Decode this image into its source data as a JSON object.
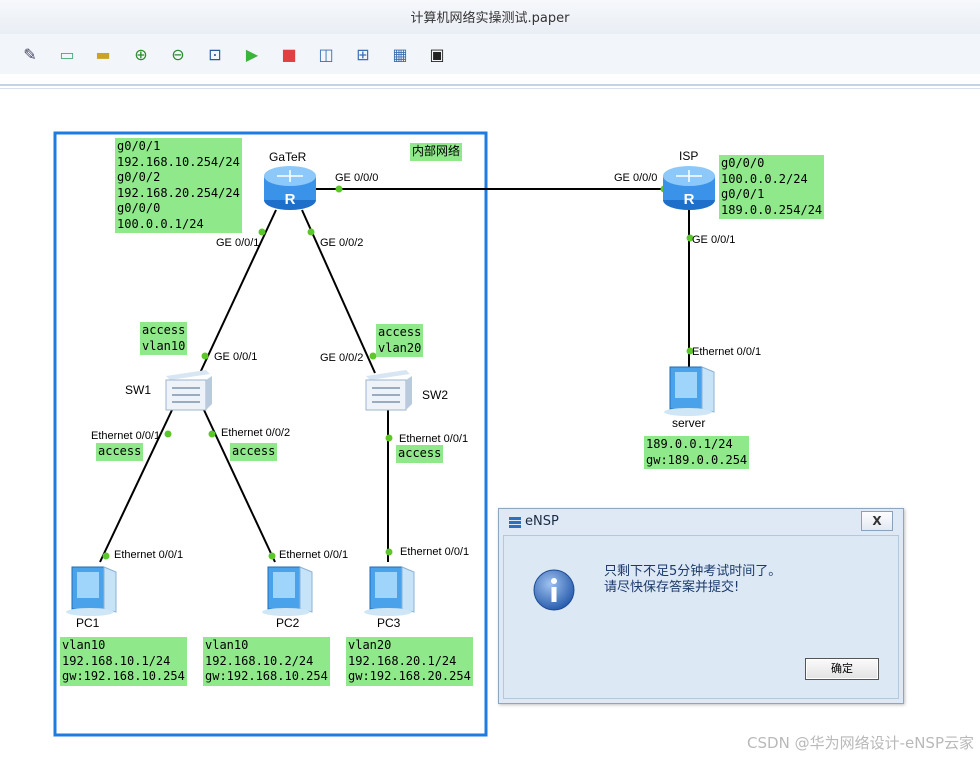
{
  "window": {
    "title": "计算机网络实操测试.paper"
  },
  "toolbar": {
    "buttons": [
      {
        "name": "settings-tool-icon",
        "glyph": "✎"
      },
      {
        "name": "text-tool-icon",
        "glyph": "▭"
      },
      {
        "name": "palette-tool-icon",
        "glyph": "▬"
      },
      {
        "name": "zoom-in-icon",
        "glyph": "⊕"
      },
      {
        "name": "zoom-out-icon",
        "glyph": "⊖"
      },
      {
        "name": "fit-view-icon",
        "glyph": "⊡"
      },
      {
        "name": "start-device-icon",
        "glyph": "▶"
      },
      {
        "name": "stop-device-icon",
        "glyph": "■"
      },
      {
        "name": "capture-icon",
        "glyph": "◫"
      },
      {
        "name": "topology-icon",
        "glyph": "⊞"
      },
      {
        "name": "grid-icon",
        "glyph": "▦"
      },
      {
        "name": "console-icon",
        "glyph": "▣"
      }
    ]
  },
  "topology": {
    "zone_label": "内部网络",
    "devices": {
      "gater": "GaTeR",
      "isp": "ISP",
      "sw1": "SW1",
      "sw2": "SW2",
      "pc1": "PC1",
      "pc2": "PC2",
      "pc3": "PC3",
      "server": "server"
    },
    "ports": {
      "gater_ge000": "GE 0/0/0",
      "isp_ge000": "GE 0/0/0",
      "gater_ge001": "GE 0/0/1",
      "gater_ge002": "GE 0/0/2",
      "isp_ge001": "GE 0/0/1",
      "server_eth": "Ethernet 0/0/1",
      "sw1_ge001": "GE 0/0/1",
      "sw2_ge002": "GE 0/0/2",
      "sw1_eth001": "Ethernet 0/0/1",
      "sw1_eth002": "Ethernet 0/0/2",
      "sw2_eth001": "Ethernet 0/0/1",
      "pc1_eth": "Ethernet 0/0/1",
      "pc2_eth": "Ethernet 0/0/1",
      "pc3_eth": "Ethernet 0/0/1"
    },
    "notes": {
      "gater": "g0/0/1\n192.168.10.254/24\ng0/0/2\n192.168.20.254/24\ng0/0/0\n100.0.0.1/24",
      "isp": "g0/0/0\n100.0.0.2/24\ng0/0/1\n189.0.0.254/24",
      "sw1_uplink": "access\nvlan10",
      "sw2_uplink": "access\nvlan20",
      "sw1_eth1": "access",
      "sw1_eth2": "access",
      "sw2_eth1": "access",
      "server": "189.0.0.1/24\ngw:189.0.0.254",
      "pc1": "vlan10\n192.168.10.1/24\ngw:192.168.10.254",
      "pc2": "vlan10\n192.168.10.2/24\ngw:192.168.10.254",
      "pc3": "vlan20\n192.168.20.1/24\ngw:192.168.20.254"
    }
  },
  "dialog": {
    "title": "eNSP",
    "close": "X",
    "message_line1": "只剩下不足5分钟考试时间了。",
    "message_line2": "请尽快保存答案并提交!",
    "ok_label": "确定"
  },
  "watermark": "CSDN @华为网络设计-eNSP云家",
  "colors": {
    "note_bg": "#8fe88a",
    "zone_border": "#1f7be0",
    "link_dot": "#5cc72a"
  }
}
